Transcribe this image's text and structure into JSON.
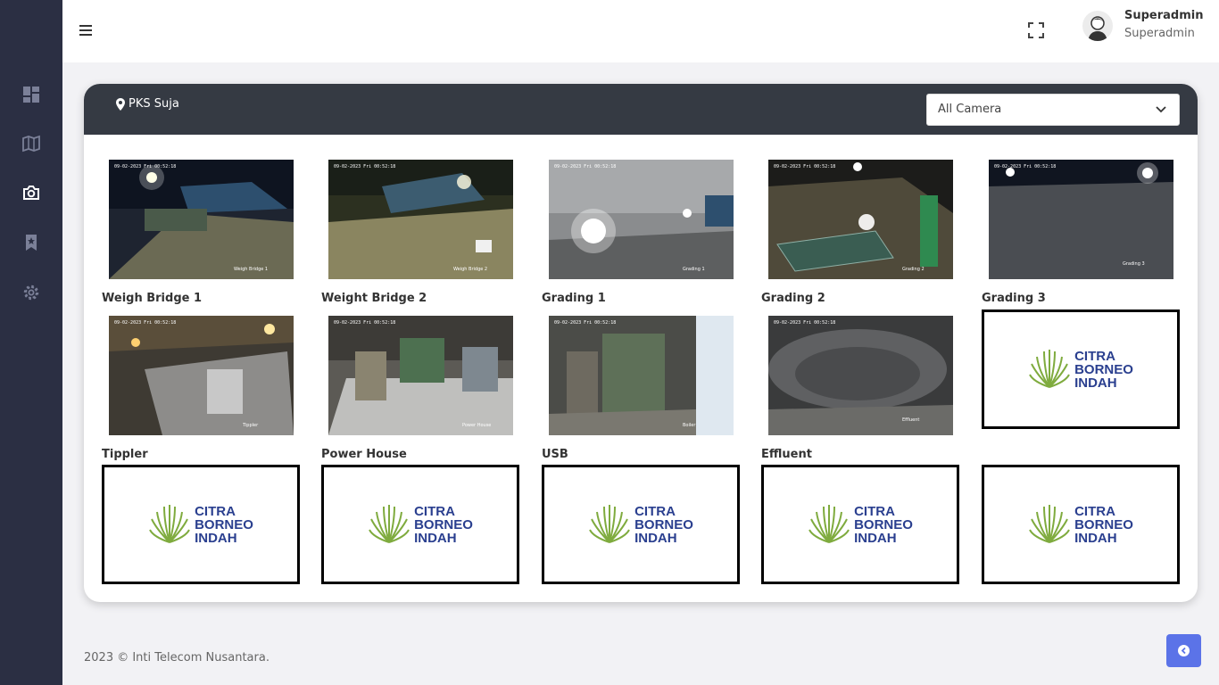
{
  "sidebar": {
    "items": [
      {
        "icon": "dashboard-icon",
        "active": false
      },
      {
        "icon": "map-icon",
        "active": false
      },
      {
        "icon": "camera-icon",
        "active": true
      },
      {
        "icon": "bookmark-icon",
        "active": false
      },
      {
        "icon": "gear-icon",
        "active": false
      }
    ]
  },
  "header": {
    "user_name": "Superadmin",
    "user_role": "Superadmin"
  },
  "card": {
    "location": "PKS Suja",
    "camera_select": "All Camera"
  },
  "cameras": [
    {
      "label": "Weigh Bridge 1",
      "type": "feed"
    },
    {
      "label": "Weight Bridge 2",
      "type": "feed"
    },
    {
      "label": "Grading 1",
      "type": "feed"
    },
    {
      "label": "Grading 2",
      "type": "feed"
    },
    {
      "label": "Grading 3",
      "type": "feed"
    },
    {
      "label": "Tippler",
      "type": "feed"
    },
    {
      "label": "Power House",
      "type": "feed"
    },
    {
      "label": "USB",
      "type": "feed"
    },
    {
      "label": "Effluent",
      "type": "feed"
    },
    {
      "label": "",
      "type": "logo"
    },
    {
      "label": "",
      "type": "logo"
    },
    {
      "label": "",
      "type": "logo"
    },
    {
      "label": "",
      "type": "logo"
    },
    {
      "label": "",
      "type": "logo"
    },
    {
      "label": "",
      "type": "logo"
    }
  ],
  "logo": {
    "line1": "CITRA",
    "line2": "BORNEO",
    "line3": "INDAH"
  },
  "footer": {
    "text": "2023 © Inti Telecom Nusantara."
  },
  "colors": {
    "sidebar": "#2b2f43",
    "card_header": "#353a43",
    "accent": "#5b73e8",
    "logo_green": "#7fab3e",
    "logo_blue": "#2a3f8f"
  }
}
